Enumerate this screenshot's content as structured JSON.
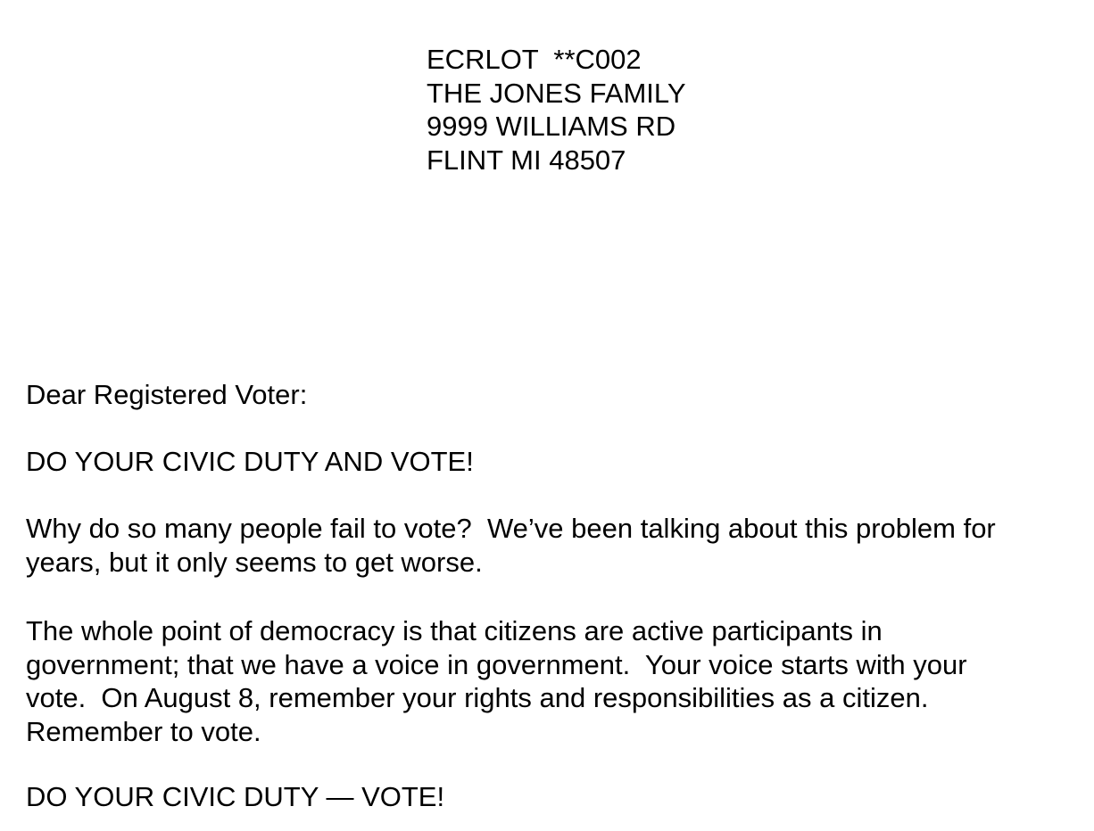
{
  "address": {
    "line1": "ECRLOT  **C002",
    "line2": "THE JONES FAMILY",
    "line3": "9999 WILLIAMS RD",
    "line4": "FLINT MI 48507"
  },
  "letter": {
    "salutation": "Dear Registered Voter:",
    "headline": "DO YOUR CIVIC DUTY AND VOTE!",
    "paragraph1": {
      "line1": "Why do so many people fail to vote?  We’ve been talking about this problem for",
      "line2": "years, but it only seems to get worse."
    },
    "paragraph2": {
      "line1": "The whole point of democracy is that citizens are active participants in",
      "line2": "government; that we have a voice in government.  Your voice starts with your",
      "line3": "vote.  On August 8, remember your rights and responsibilities as a citizen.",
      "line4": "Remember to vote."
    },
    "closing": "DO YOUR CIVIC DUTY — VOTE!"
  }
}
